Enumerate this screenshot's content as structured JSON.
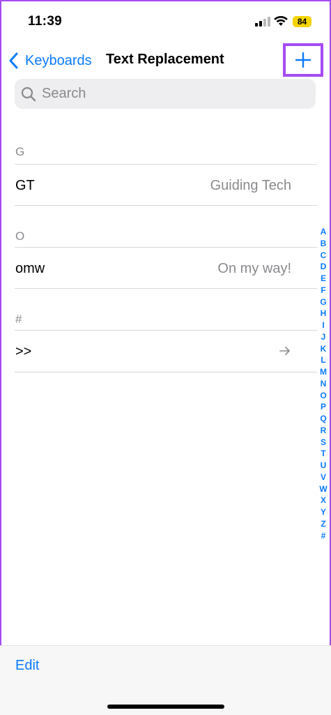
{
  "status_bar": {
    "time": "11:39",
    "battery": "84"
  },
  "nav": {
    "back_label": "Keyboards",
    "title": "Text Replacement"
  },
  "search": {
    "placeholder": "Search"
  },
  "sections": [
    {
      "header": "G",
      "rows": [
        {
          "phrase": "GT",
          "shortcut": "Guiding Tech"
        }
      ]
    },
    {
      "header": "O",
      "rows": [
        {
          "phrase": "omw",
          "shortcut": "On my way!"
        }
      ]
    },
    {
      "header": "#",
      "rows": [
        {
          "phrase": ">>",
          "shortcut": ""
        }
      ]
    }
  ],
  "index_letters": [
    "A",
    "B",
    "C",
    "D",
    "E",
    "F",
    "G",
    "H",
    "I",
    "J",
    "K",
    "L",
    "M",
    "N",
    "O",
    "P",
    "Q",
    "R",
    "S",
    "T",
    "U",
    "V",
    "W",
    "X",
    "Y",
    "Z",
    "#"
  ],
  "toolbar": {
    "edit_label": "Edit"
  },
  "colors": {
    "accent": "#0a7aff",
    "highlight": "#a64bf2",
    "battery": "#f5d400"
  }
}
